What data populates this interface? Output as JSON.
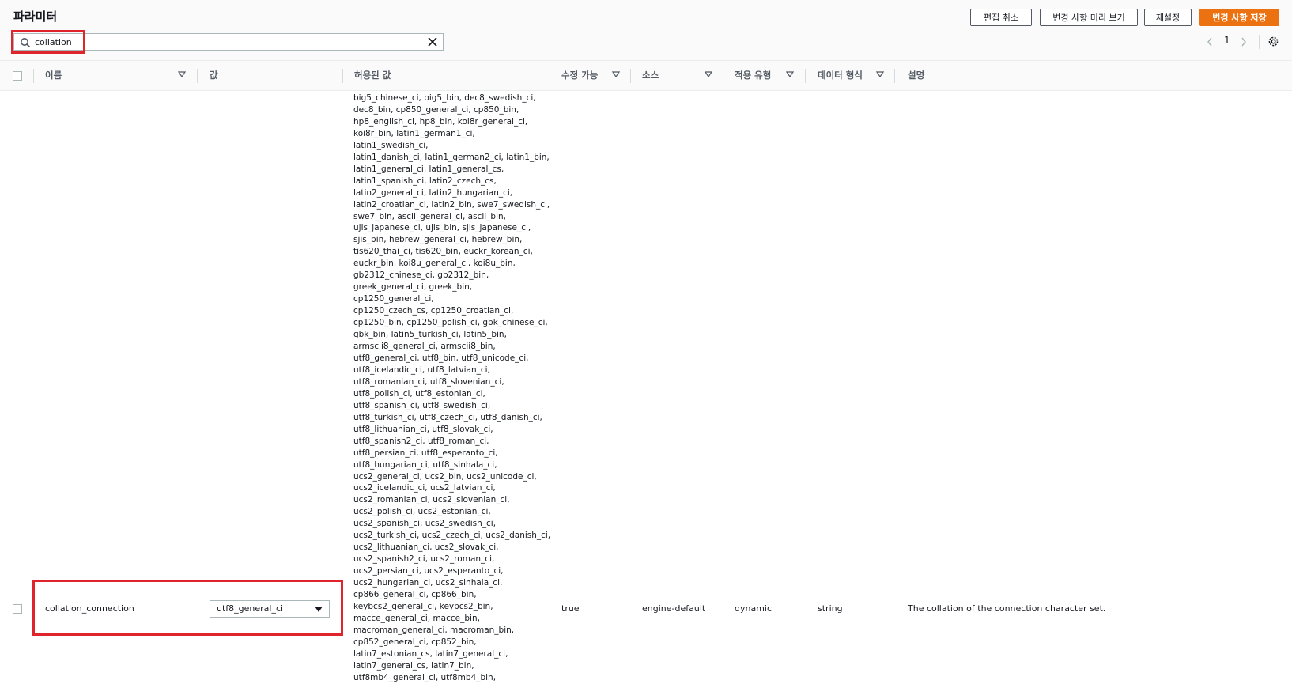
{
  "header": {
    "title": "파라미터",
    "buttons": {
      "cancel": "편집 취소",
      "preview": "변경 사항 미리 보기",
      "reset": "재설정",
      "save": "변경 사항 저장"
    }
  },
  "search": {
    "value": "collation",
    "placeholder": ""
  },
  "pagination": {
    "current": "1"
  },
  "columns": {
    "name": "이름",
    "value": "값",
    "allowed": "허용된 값",
    "modifiable": "수정 가능",
    "source": "소스",
    "apply_type": "적용 유형",
    "data_type": "데이터 형식",
    "description": "설명"
  },
  "row": {
    "name": "collation_connection",
    "value": "utf8_general_ci",
    "allowed_values": "big5_chinese_ci, big5_bin, dec8_swedish_ci,\ndec8_bin, cp850_general_ci, cp850_bin,\nhp8_english_ci, hp8_bin, koi8r_general_ci,\nkoi8r_bin, latin1_german1_ci, latin1_swedish_ci,\nlatin1_danish_ci, latin1_german2_ci, latin1_bin,\nlatin1_general_ci, latin1_general_cs,\nlatin1_spanish_ci, latin2_czech_cs,\nlatin2_general_ci, latin2_hungarian_ci,\nlatin2_croatian_ci, latin2_bin, swe7_swedish_ci,\nswe7_bin, ascii_general_ci, ascii_bin,\nujis_japanese_ci, ujis_bin, sjis_japanese_ci,\nsjis_bin, hebrew_general_ci, hebrew_bin,\ntis620_thai_ci, tis620_bin, euckr_korean_ci,\neuckr_bin, koi8u_general_ci, koi8u_bin,\ngb2312_chinese_ci, gb2312_bin,\ngreek_general_ci, greek_bin, cp1250_general_ci,\ncp1250_czech_cs, cp1250_croatian_ci,\ncp1250_bin, cp1250_polish_ci, gbk_chinese_ci,\ngbk_bin, latin5_turkish_ci, latin5_bin,\narmscii8_general_ci, armscii8_bin,\nutf8_general_ci, utf8_bin, utf8_unicode_ci,\nutf8_icelandic_ci, utf8_latvian_ci,\nutf8_romanian_ci, utf8_slovenian_ci,\nutf8_polish_ci, utf8_estonian_ci,\nutf8_spanish_ci, utf8_swedish_ci,\nutf8_turkish_ci, utf8_czech_ci, utf8_danish_ci,\nutf8_lithuanian_ci, utf8_slovak_ci,\nutf8_spanish2_ci, utf8_roman_ci,\nutf8_persian_ci, utf8_esperanto_ci,\nutf8_hungarian_ci, utf8_sinhala_ci,\nucs2_general_ci, ucs2_bin, ucs2_unicode_ci,\nucs2_icelandic_ci, ucs2_latvian_ci,\nucs2_romanian_ci, ucs2_slovenian_ci,\nucs2_polish_ci, ucs2_estonian_ci,\nucs2_spanish_ci, ucs2_swedish_ci,\nucs2_turkish_ci, ucs2_czech_ci, ucs2_danish_ci,\nucs2_lithuanian_ci, ucs2_slovak_ci,\nucs2_spanish2_ci, ucs2_roman_ci,\nucs2_persian_ci, ucs2_esperanto_ci,\nucs2_hungarian_ci, ucs2_sinhala_ci,\ncp866_general_ci, cp866_bin,\nkeybcs2_general_ci, keybcs2_bin,\nmacce_general_ci, macce_bin,\nmacroman_general_ci, macroman_bin,\ncp852_general_ci, cp852_bin,\nlatin7_estonian_cs, latin7_general_ci,\nlatin7_general_cs, latin7_bin,\nutf8mb4_general_ci, utf8mb4_bin,",
    "modifiable": "true",
    "source": "engine-default",
    "apply_type": "dynamic",
    "data_type": "string",
    "description": "The collation of the connection character set."
  },
  "colors": {
    "accent": "#ec7211",
    "highlight": "#e0242b"
  }
}
